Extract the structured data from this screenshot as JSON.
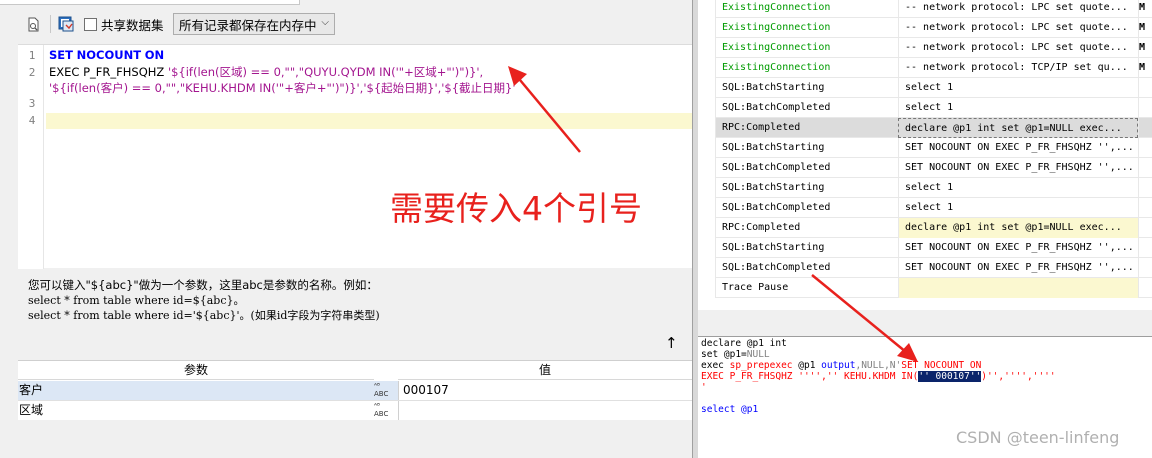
{
  "toolbar": {
    "share_label": "共享数据集",
    "save_mode_value": "所有记录都保存在内存中"
  },
  "editor": {
    "line_numbers": [
      "1",
      "2",
      "3",
      "4"
    ],
    "line1": {
      "kw1": "SET",
      "kw2": "NOCOUNT",
      "kw3": "ON"
    },
    "line2": {
      "exec": "EXEC P_FR_FHSQHZ ",
      "part1": "'${if(len(区域) == 0,\"\",\"QUYU.QYDM IN('\"+区域+\"')\")}',"
    },
    "line3": {
      "part1": "'${if(len(客户) == 0,\"\",\"KEHU.KHDM IN('\"+客户+\"')\")}','${起始日期}','${截止日期}'"
    }
  },
  "annotation": {
    "text": "需要传入4个引号"
  },
  "note": {
    "line1": "您可以键入\"${abc}\"做为一个参数，这里abc是参数的名称。例如：",
    "line2": "select * from table where id=${abc}。",
    "line3": "select * from table where id='${abc}'。(如果id字段为字符串类型)"
  },
  "params": {
    "col_name": "参数",
    "col_value": "值",
    "rows": [
      {
        "name": "客户",
        "value": "000107"
      },
      {
        "name": "区域",
        "value": ""
      }
    ]
  },
  "trace": {
    "rows": [
      {
        "event": "ExistingConnection",
        "text": "-- network protocol: LPC  set quote...",
        "extra": "M"
      },
      {
        "event": "ExistingConnection",
        "text": "-- network protocol: LPC  set quote...",
        "extra": "M"
      },
      {
        "event": "ExistingConnection",
        "text": "-- network protocol: LPC  set quote...",
        "extra": "M"
      },
      {
        "event": "ExistingConnection",
        "text": "-- network protocol: TCP/IP  set qu...",
        "extra": "M"
      },
      {
        "event": "SQL:BatchStarting",
        "text": "select 1",
        "extra": ""
      },
      {
        "event": "SQL:BatchCompleted",
        "text": "select 1",
        "extra": ""
      },
      {
        "event": "RPC:Completed",
        "text": "declare @p1 int  set @p1=NULL  exec...",
        "extra": ""
      },
      {
        "event": "SQL:BatchStarting",
        "text": "SET NOCOUNT ON EXEC P_FR_FHSQHZ '',...",
        "extra": ""
      },
      {
        "event": "SQL:BatchCompleted",
        "text": "SET NOCOUNT ON EXEC P_FR_FHSQHZ '',...",
        "extra": ""
      },
      {
        "event": "SQL:BatchStarting",
        "text": "select 1",
        "extra": ""
      },
      {
        "event": "SQL:BatchCompleted",
        "text": "select 1",
        "extra": ""
      },
      {
        "event": "RPC:Completed",
        "text": "declare @p1 int  set @p1=NULL  exec...",
        "extra": ""
      },
      {
        "event": "SQL:BatchStarting",
        "text": "SET NOCOUNT ON EXEC P_FR_FHSQHZ '',...",
        "extra": ""
      },
      {
        "event": "SQL:BatchCompleted",
        "text": "SET NOCOUNT ON EXEC P_FR_FHSQHZ '',...",
        "extra": ""
      },
      {
        "event": "Trace Pause",
        "text": "",
        "extra": ""
      }
    ]
  },
  "detail": {
    "l1": "declare @p1 int",
    "l2a": "set @p1=",
    "l2b": "NULL",
    "l3a": "exec ",
    "l3b": "sp_prepexec",
    "l3c": " @p1 ",
    "l3d": "output",
    "l3e": ",NULL,N'",
    "l3f": "SET NOCOUNT ON",
    "l4a": "EXEC P_FR_FHSQHZ '''','' KEHU.KHDM IN(",
    "l4b": "'' 000107''",
    "l4c": ")'','''',''''",
    "l5": "'",
    "l6": "select @p1"
  },
  "watermark": "CSDN @teen-linfeng",
  "colors": {
    "annotation_red": "#e8211d",
    "keyword_blue": "#0000ff",
    "string_magenta": "#a3158f",
    "event_green": "#009b00"
  }
}
